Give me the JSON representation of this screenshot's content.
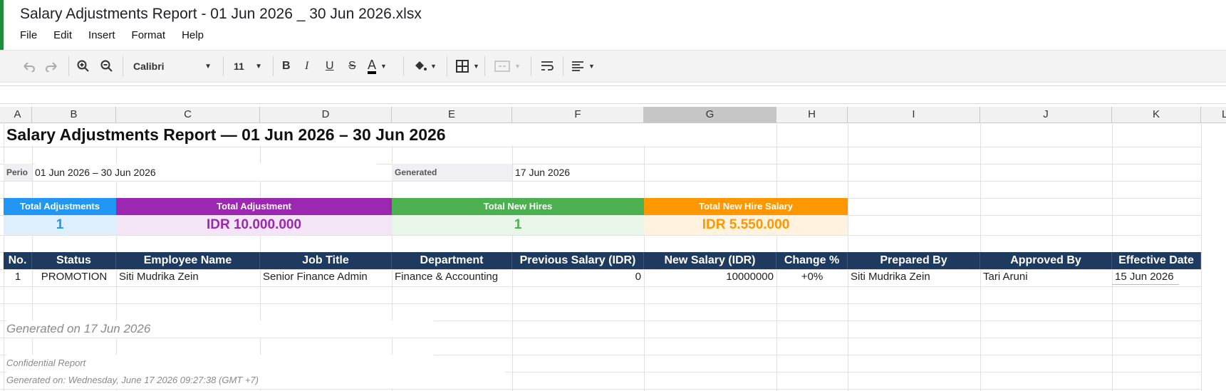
{
  "window": {
    "title": "Salary Adjustments Report - 01 Jun 2026 _ 30 Jun 2026.xlsx"
  },
  "menu": [
    "File",
    "Edit",
    "Insert",
    "Format",
    "Help"
  ],
  "toolbar": {
    "font_name": "Calibri",
    "font_size": "11"
  },
  "columns": [
    "A",
    "B",
    "C",
    "D",
    "E",
    "F",
    "G",
    "H",
    "I",
    "J",
    "K",
    "L"
  ],
  "selected_column": "G",
  "sheet": {
    "title": "Salary Adjustments Report — 01 Jun 2026 – 30 Jun 2026",
    "period_label": "Perio",
    "period_value": "01 Jun 2026 – 30 Jun 2026",
    "generated_label": "Generated",
    "generated_value": "17 Jun 2026",
    "cards": [
      {
        "label": "Total Adjustments",
        "value": "1",
        "head_color": "#2196f3",
        "body_color": "#ddeefc",
        "text_color": "#2196f3"
      },
      {
        "label": "Total Adjustment",
        "value": "IDR 10.000.000",
        "head_color": "#9c27b0",
        "body_color": "#f3e5f5",
        "text_color": "#9c27b0"
      },
      {
        "label": "Total New Hires",
        "value": "1",
        "head_color": "#4caf50",
        "body_color": "#e8f5e9",
        "text_color": "#4caf50"
      },
      {
        "label": "Total New Hire Salary",
        "value": "IDR 5.550.000",
        "head_color": "#ff9800",
        "body_color": "#fff3e0",
        "text_color": "#ff9800"
      }
    ],
    "table_headers": [
      "No.",
      "Status",
      "Employee Name",
      "Job Title",
      "Department",
      "Previous Salary (IDR)",
      "New Salary (IDR)",
      "Change %",
      "Prepared By",
      "Approved By",
      "Effective Date"
    ],
    "rows": [
      [
        "1",
        "PROMOTION",
        "Siti Mudrika Zein",
        "Senior Finance Admin",
        "Finance & Accounting",
        "0",
        "10000000",
        "+0%",
        "Siti Mudrika Zein",
        "Tari Aruni",
        "15 Jun 2026"
      ]
    ],
    "generated_note": "Generated on 17 Jun 2026",
    "confidential": "Confidential Report",
    "generated_on": "Generated on: Wednesday, June 17 2026 09:27:38 (GMT +7)"
  },
  "colors": {
    "header_bg": "#1f3a5f",
    "accent": "#1e8e3e"
  }
}
